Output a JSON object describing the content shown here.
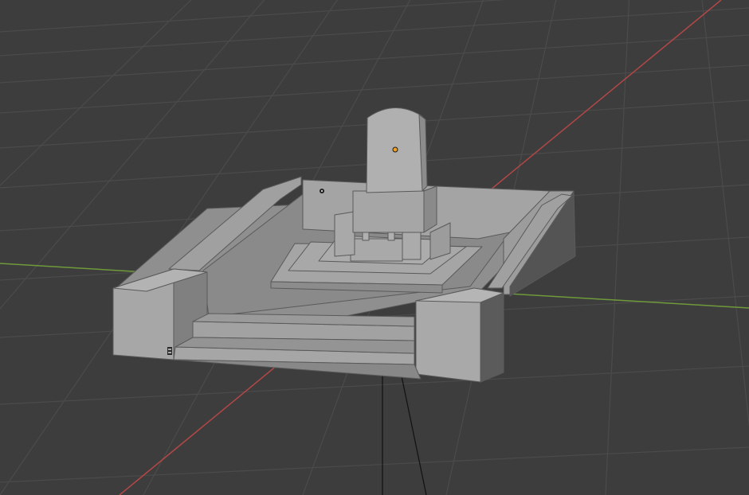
{
  "viewport": {
    "background_color": "#3d3d3d",
    "grid_color": "#4a4a4a",
    "x_axis_color": "#b34747",
    "y_axis_color": "#6f9a3a",
    "object_color": "#9a9a9a",
    "object_origin_color": "#f0a020",
    "cursor_icon": "3d-cursor-icon",
    "light_icon": "light-icon",
    "camera_icon": "camera-icon"
  }
}
